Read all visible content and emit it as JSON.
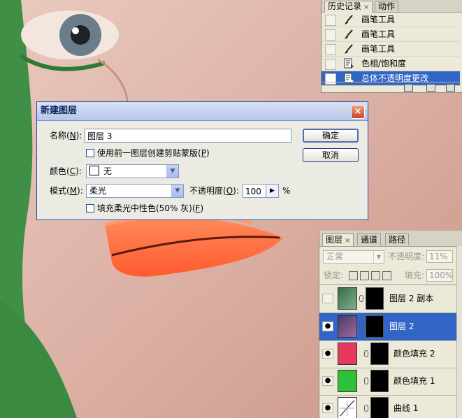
{
  "history": {
    "tabs": [
      {
        "label": "历史记录",
        "close": "×"
      },
      {
        "label": "动作"
      }
    ],
    "items": [
      {
        "label": "画笔工具",
        "icon": "brush-icon"
      },
      {
        "label": "画笔工具",
        "icon": "brush-icon"
      },
      {
        "label": "画笔工具",
        "icon": "brush-icon"
      },
      {
        "label": "色相/饱和度",
        "icon": "adjustment-icon"
      },
      {
        "label": "总体不透明度更改",
        "icon": "adjustment-icon",
        "selected": true
      }
    ]
  },
  "dialog": {
    "title": "新建图层",
    "close": "×",
    "name_label_prefix": "名称(",
    "name_label_key": "N",
    "name_label_suffix": "):",
    "name_value": "图层 3",
    "clip_label_prefix": "使用前一图层创建剪贴蒙版(",
    "clip_label_key": "P",
    "clip_label_suffix": ")",
    "color_label_prefix": "颜色(",
    "color_label_key": "C",
    "color_label_suffix": "):",
    "color_value": "无",
    "mode_label_prefix": "模式(",
    "mode_label_key": "M",
    "mode_label_suffix": "):",
    "mode_value": "柔光",
    "opacity_label_prefix": "不透明度(",
    "opacity_label_key": "O",
    "opacity_label_suffix": "):",
    "opacity_value": "100",
    "opacity_unit": "%",
    "fill_label_prefix": "填充柔光中性色(50% 灰)(",
    "fill_label_key": "F",
    "fill_label_suffix": ")",
    "ok_label": "确定",
    "cancel_label": "取消"
  },
  "layers": {
    "tabs": [
      {
        "label": "图层",
        "close": "×"
      },
      {
        "label": "通道"
      },
      {
        "label": "路径"
      }
    ],
    "blend_mode": "正常",
    "opacity_label": "不透明度:",
    "opacity_value": "11%",
    "lock_label": "锁定:",
    "fill_label": "填充:",
    "fill_value": "100%",
    "items": [
      {
        "name": "图层 2 副本",
        "visible": false,
        "thumb_color": "#4a8a5a"
      },
      {
        "name": "图层 2",
        "visible": true,
        "selected": true,
        "thumb_color": "#6a4f8a"
      },
      {
        "name": "颜色填充 2",
        "visible": true,
        "thumb_color": "#e53a5c"
      },
      {
        "name": "颜色填充 1",
        "visible": true,
        "thumb_color": "#2fbf3a"
      },
      {
        "name": "曲线 1",
        "visible": true,
        "thumb_color": "#ffffff"
      }
    ]
  },
  "colors": {
    "selection": "#3165c6",
    "canvas_green": "#3f8f47",
    "lip_orange": "#ff6a3a"
  }
}
